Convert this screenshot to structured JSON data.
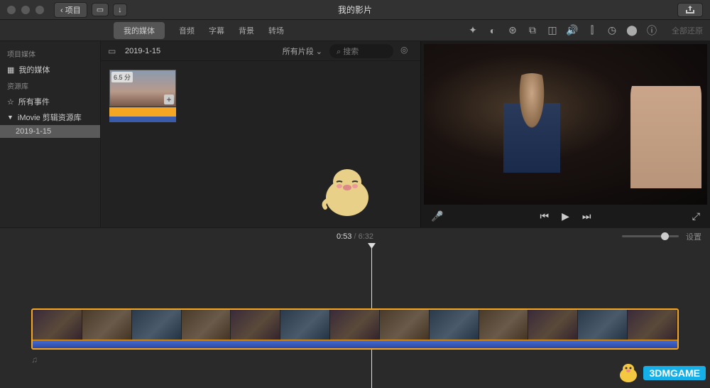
{
  "titlebar": {
    "back_label": "项目",
    "title": "我的影片"
  },
  "tabs": {
    "my_media": "我的媒体",
    "audio": "音频",
    "subtitle": "字幕",
    "background": "背景",
    "transition": "转场",
    "adjust_all": "全部还原"
  },
  "sidebar": {
    "section_project": "项目媒体",
    "my_media": "我的媒体",
    "section_library": "资源库",
    "all_events": "所有事件",
    "imovie_lib": "iMovie 剪辑资源库",
    "event_date": "2019-1-15"
  },
  "browser": {
    "event_title": "2019-1-15",
    "filter_label": "所有片段",
    "search_placeholder": "搜索",
    "clip_duration": "6.5 分"
  },
  "timeline": {
    "current": "0:53",
    "total": "6:32",
    "settings": "设置"
  },
  "watermark": "3DMGAME"
}
